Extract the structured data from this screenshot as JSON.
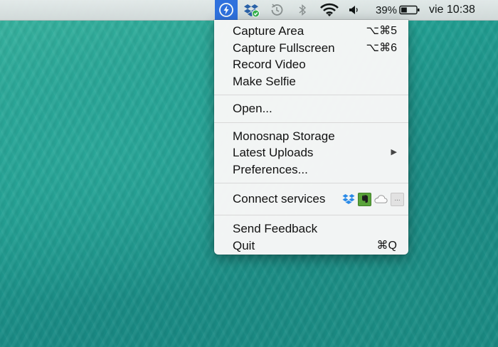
{
  "menubar": {
    "app_icon": "monosnap-bolt-icon",
    "status_icons": [
      "dropbox-synced-icon",
      "time-machine-icon",
      "bluetooth-icon",
      "wifi-icon",
      "volume-icon"
    ],
    "battery_percent": "39%",
    "battery_level": 0.39,
    "clock": "vie 10:38"
  },
  "menu": {
    "group1": [
      {
        "label": "Capture Area",
        "shortcut": "⌥⌘5"
      },
      {
        "label": "Capture Fullscreen",
        "shortcut": "⌥⌘6"
      },
      {
        "label": "Record Video",
        "shortcut": ""
      },
      {
        "label": "Make Selfie",
        "shortcut": ""
      }
    ],
    "open_label": "Open...",
    "group3": [
      {
        "label": "Monosnap Storage"
      },
      {
        "label": "Latest Uploads",
        "submenu_arrow": "▶"
      },
      {
        "label": "Preferences..."
      }
    ],
    "connect_label": "Connect services",
    "services": [
      "dropbox-icon",
      "evernote-icon",
      "cloud-icon",
      "more-icon"
    ],
    "more_label": "...",
    "feedback_label": "Send Feedback",
    "quit_label": "Quit",
    "quit_shortcut": "⌘Q"
  },
  "colors": {
    "app_highlight": "#2f6fe0",
    "evernote": "#5aa33a",
    "dropbox": "#2a8ae8",
    "desktop": "#219f92"
  }
}
